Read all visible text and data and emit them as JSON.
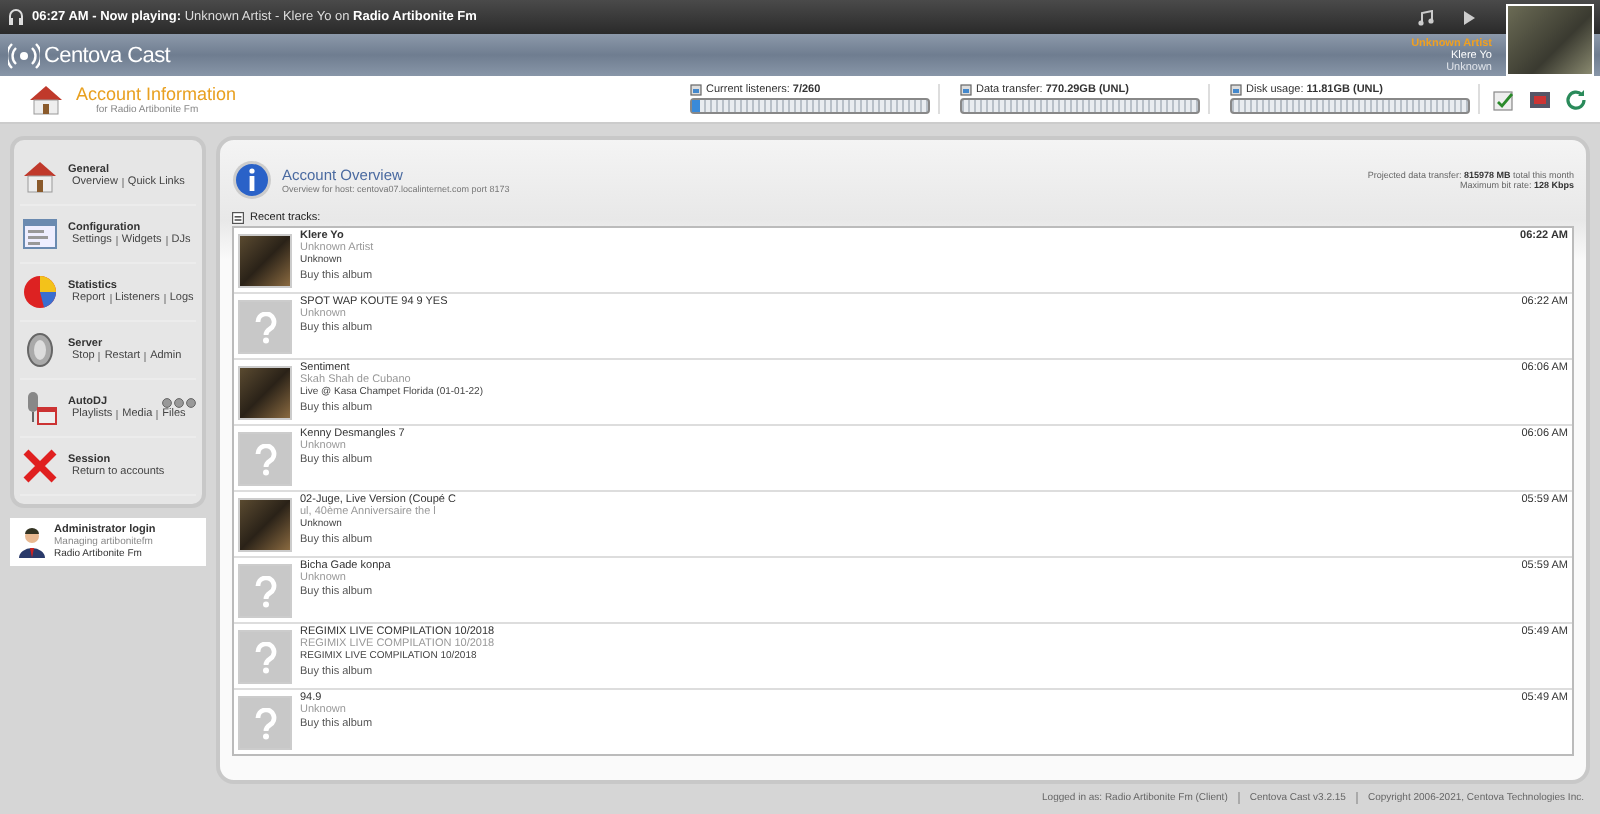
{
  "top_bar": {
    "now_playing": "**06:27 AM - Now playing:** Unknown Artist - Klere Yo on **Radio Artibonite Fm**"
  },
  "header": {
    "logo": "Centova Cast",
    "current": {
      "artist": "Unknown Artist",
      "title": "Klere Yo",
      "album": "Unknown"
    }
  },
  "page": {
    "title": "Account Information",
    "subtitle": "for Radio Artibonite Fm"
  },
  "meters": [
    {
      "label": "Current listeners: **7/260**",
      "level": 0.03
    },
    {
      "label": "Data transfer: **770.29GB (UNL)**",
      "level": 0
    },
    {
      "label": "Disk usage: **11.81GB (UNL)**",
      "level": 0
    }
  ],
  "sidebar": {
    "items": [
      {
        "kind": "home",
        "title": "General",
        "links": [
          "Overview",
          "Quick Links"
        ]
      },
      {
        "kind": "config",
        "title": "Configuration",
        "links": [
          "Settings",
          "Widgets",
          "DJs"
        ]
      },
      {
        "kind": "stats",
        "title": "Statistics",
        "links": [
          "Report",
          "Listeners",
          "Logs"
        ]
      },
      {
        "kind": "server",
        "title": "Server",
        "links": [
          "Stop",
          "Restart",
          "Admin"
        ]
      },
      {
        "kind": "autodj",
        "title": "AutoDJ",
        "links": [
          "Playlists",
          "Media",
          "Files"
        ]
      },
      {
        "kind": "session",
        "title": "Session",
        "links": [
          "Return to accounts"
        ]
      }
    ],
    "admin": {
      "title": "Administrator login",
      "line_1": "Managing artibonitefm",
      "line_2": "Radio Artibonite Fm"
    }
  },
  "overview": {
    "title": "Account Overview",
    "subtitle": "Overview for host: centova07.localinternet.com port 8173",
    "stats": [
      "Projected data transfer: **815978 MB** total this month",
      "Maximum bit rate: **128 Kbps**"
    ],
    "recent_label": "Recent tracks:",
    "tracks": [
      {
        "kind": "photo",
        "current": true,
        "title": "Klere Yo",
        "artist": "Unknown Artist",
        "album": "Unknown",
        "link": "Buy this album",
        "time": "06:22 AM"
      },
      {
        "kind": "unknown",
        "current": false,
        "title": "SPOT WAP KOUTE 94 9 YES",
        "artist": "Unknown",
        "link": "Buy this album",
        "time": "06:22 AM"
      },
      {
        "kind": "photo",
        "current": false,
        "title": "Sentiment",
        "artist": "Skah Shah de Cubano",
        "album": "Live @ Kasa Champet Florida (01-01-22)",
        "link": "Buy this album",
        "time": "06:06 AM"
      },
      {
        "kind": "unknown",
        "current": false,
        "title": "Kenny Desmangles 7",
        "artist": "Unknown",
        "link": "Buy this album",
        "time": "06:06 AM"
      },
      {
        "kind": "photo",
        "current": false,
        "title": "02-Juge, Live Version (Coupé C",
        "artist": "ul, 40ème Anniversaire the l",
        "album": "Unknown",
        "link": "Buy this album",
        "time": "05:59 AM"
      },
      {
        "kind": "unknown",
        "current": false,
        "title": "Bicha Gade konpa",
        "artist": "Unknown",
        "link": "Buy this album",
        "time": "05:59 AM"
      },
      {
        "kind": "unknown",
        "current": false,
        "title": "REGIMIX LIVE COMPILATION 10/2018",
        "artist": "REGIMIX LIVE COMPILATION 10/2018",
        "album": "REGIMIX LIVE COMPILATION 10/2018",
        "link": "Buy this album",
        "time": "05:49 AM"
      },
      {
        "kind": "unknown",
        "current": false,
        "title": "94.9",
        "artist": "Unknown",
        "link": "Buy this album",
        "time": "05:49 AM"
      }
    ]
  },
  "footer": [
    "Logged in as: Radio Artibonite Fm (Client)",
    "Centova Cast v3.2.15",
    "Copyright 2006-2021, Centova Technologies Inc."
  ]
}
